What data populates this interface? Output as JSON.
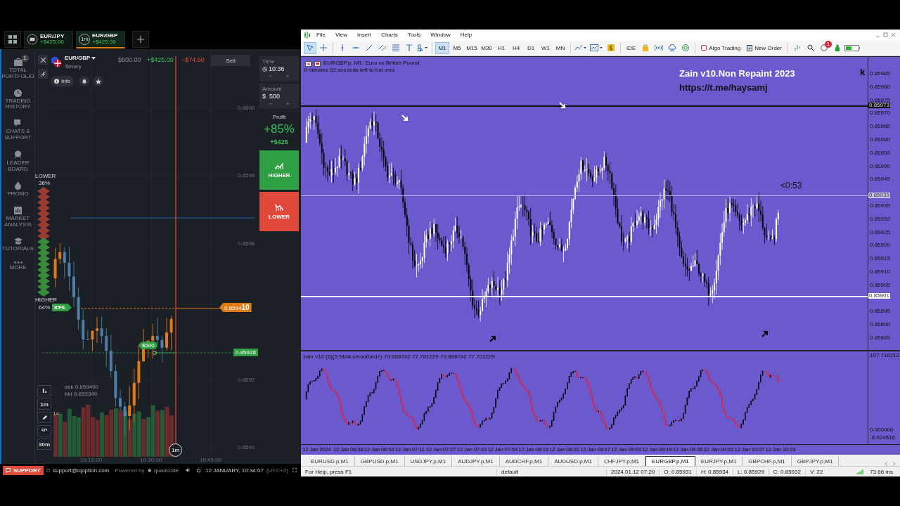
{
  "iq": {
    "tabs": [
      {
        "kind": "flag",
        "pair": "EUR/JPY",
        "profit": "+$425.00",
        "selected": false
      },
      {
        "kind": "timer",
        "badge": "1m",
        "pair": "EUR/GBP",
        "profit": "+$425.00",
        "selected": true
      }
    ],
    "sidebar": [
      {
        "kind": "briefcase",
        "label": "TOTAL PORTFOLIO",
        "badge": "1"
      },
      {
        "kind": "clock",
        "label": "TRADING HISTORY"
      },
      {
        "kind": "chat",
        "label": "CHATS & SUPPORT"
      },
      {
        "kind": "medal",
        "label": "LEADER BOARD"
      },
      {
        "kind": "flame",
        "label": "PROMO"
      },
      {
        "kind": "chart",
        "label": "MARKET ANALYSIS"
      },
      {
        "kind": "cap",
        "label": "TUTORIALS"
      },
      {
        "kind": "dots",
        "label": "MORE"
      }
    ],
    "asset": {
      "name": "EUR/GBP",
      "type": "Binary",
      "investment": "$500.00",
      "profit": "+$425.00",
      "loss": "−$74.50",
      "sell": "Sell",
      "info": "Info"
    },
    "chart": {
      "price_labels": [
        "0.8600",
        "0.8598",
        "0.8596",
        "0.8592",
        "0.8590"
      ],
      "time_labels": [
        "10:15:00",
        "10:30:00",
        "10:45:00"
      ],
      "lower": {
        "label": "LOWER",
        "percent": "36%"
      },
      "higher": {
        "label": "HIGHER",
        "percent": "64%",
        "payout": "85%"
      },
      "current_price": "0.8594**10**",
      "deal_amount": "$500",
      "strike_price": "0.85928",
      "expiry": "1m",
      "ask": "ask 0.859400",
      "bid": "bid 0.859340",
      "tools": [
        {
          "kind": "candles"
        },
        {
          "kind": "text",
          "label": "1m"
        },
        {
          "kind": "pencil",
          "badge": "14"
        },
        {
          "kind": "wave"
        },
        {
          "kind": "text",
          "label": "30m"
        }
      ]
    },
    "panel": {
      "time_label": "Time",
      "time": "10:36",
      "amount_label": "Amount",
      "currency": "$",
      "amount": "500",
      "minus": "−",
      "plus": "+",
      "profit_label": "Profit",
      "profit_percent": "+85%",
      "profit_amount": "+$425",
      "higher": "HIGHER",
      "lower": "LOWER"
    },
    "footer": {
      "support": "SUPPORT",
      "email": "support@iqoption.com",
      "powered": "Powered by",
      "brand": "quadcode",
      "datetime": "12 JANUARY, 10:34:07",
      "timezone": "(UTC+2)"
    }
  },
  "mt5": {
    "menu": [
      "File",
      "View",
      "Insert",
      "Charts",
      "Tools",
      "Window",
      "Help"
    ],
    "timeframes": [
      {
        "label": "M1",
        "selected": true
      },
      {
        "label": "M5",
        "selected": false
      },
      {
        "label": "M15",
        "selected": false
      },
      {
        "label": "M30",
        "selected": false
      },
      {
        "label": "H1",
        "selected": false
      },
      {
        "label": "H4",
        "selected": false
      },
      {
        "label": "D1",
        "selected": false
      },
      {
        "label": "W1",
        "selected": false
      },
      {
        "label": "MN",
        "selected": false
      }
    ],
    "ide": "IDE",
    "algo_trading": "Algo Trading",
    "new_order": "New Order",
    "notifications": "1",
    "chart": {
      "symbol": "EURGBP.p, M1:  Euro vs British Pound",
      "countdown": "0 minutes 53 seconds left to bar end",
      "overlay_title": "Zain v10.Non Repaint 2023",
      "overlay_link": "https://t.me/haysamj",
      "corner": "k",
      "bar_timer": "<0:53",
      "price_labels": [
        "0.85985",
        "0.85980",
        "0.85975",
        "0.85970",
        "0.85965",
        "0.85960",
        "0.85955",
        "0.85950",
        "0.85945",
        "0.85935",
        "0.85930",
        "0.85925",
        "0.85920",
        "0.85915",
        "0.85910",
        "0.85905",
        "0.85895",
        "0.85890",
        "0.85885"
      ],
      "levels": [
        {
          "kind": "resistance",
          "price": "0.85973"
        },
        {
          "kind": "bid",
          "price": "0.85939"
        },
        {
          "kind": "support",
          "price": "0.85901"
        }
      ]
    },
    "indicator": {
      "label": "zain v10 (5)(5 SMA smoothed+) 70.898742 77.701229 70.898742 77.701229",
      "axis": [
        "107.719212",
        "0.000000",
        "-8.924516"
      ]
    },
    "time_labels": [
      "12 Jan 2024",
      "12 Jan 06:38",
      "12 Jan 06:54",
      "12 Jan 07:11",
      "12 Jan 07:27",
      "12 Jan 07:43",
      "12 Jan 07:59",
      "12 Jan 08:15",
      "12 Jan 08:31",
      "12 Jan 08:47",
      "12 Jan 09:03",
      "12 Jan 09:19",
      "12 Jan 09:35",
      "12 Jan 09:51",
      "12 Jan 10:07",
      "12 Jan 10:23"
    ],
    "symbol_tabs": [
      {
        "label": "EURUSD.p,M1",
        "selected": false
      },
      {
        "label": "GBPUSD.p,M1",
        "selected": false
      },
      {
        "label": "USDJPY.p,M1",
        "selected": false
      },
      {
        "label": "AUDJPY.p,M1",
        "selected": false
      },
      {
        "label": "AUDCHF.p,M1",
        "selected": false
      },
      {
        "label": "AUDUSD.p,M1",
        "selected": false
      },
      {
        "label": "CHFJPY.p,M1",
        "selected": false
      },
      {
        "label": "EURGBP.p,M1",
        "selected": true
      },
      {
        "label": "EURJPY.p,M1",
        "selected": false
      },
      {
        "label": "GBPCHF.p,M1",
        "selected": false
      },
      {
        "label": "GBPJPY.p,M1",
        "selected": false
      }
    ],
    "status": {
      "help": "For Help, press F1",
      "profile": "default",
      "time": "2024.01.12 07:20",
      "open": "O: 0.85931",
      "high": "H: 0.85934",
      "low": "L: 0.85929",
      "close": "C: 0.85932",
      "volume": "V: 22",
      "ping": "73.66 ms"
    }
  }
}
